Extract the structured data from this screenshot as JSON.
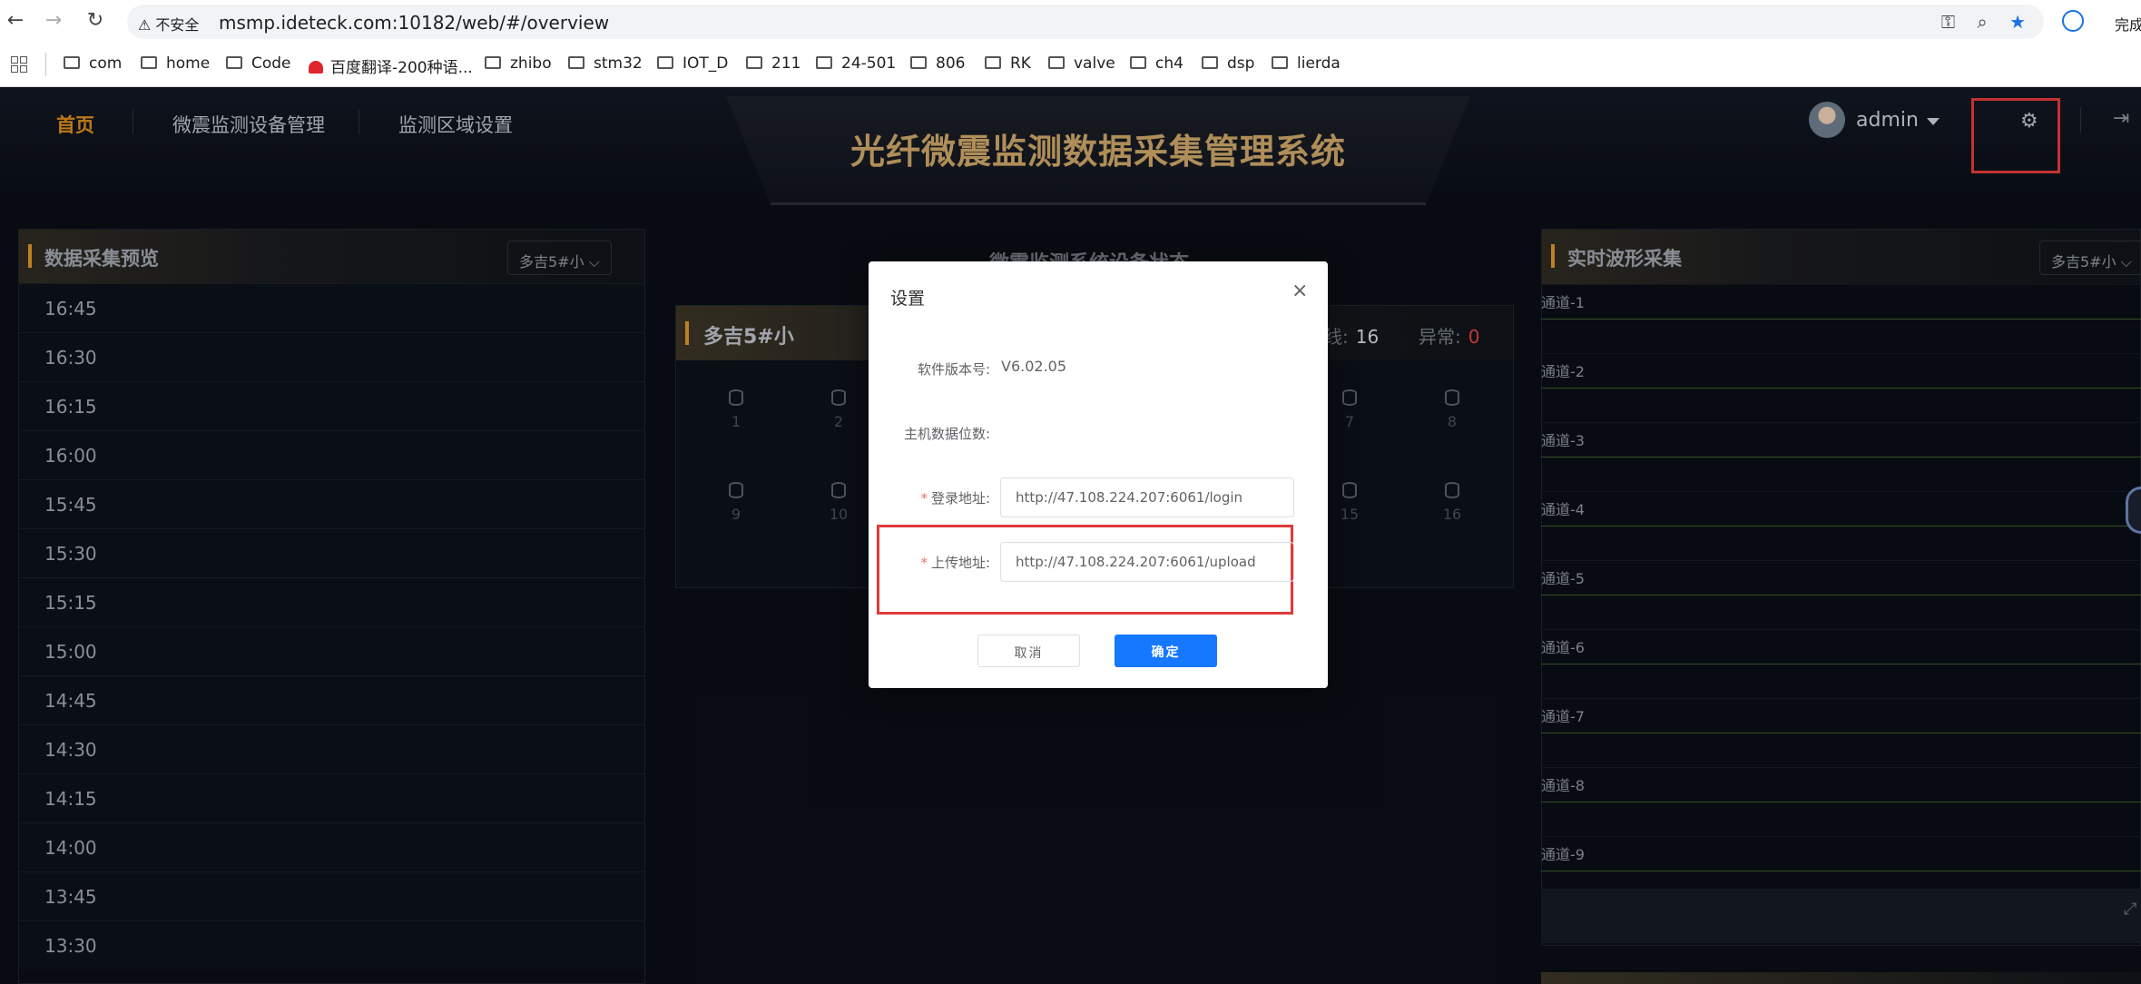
{
  "browser": {
    "back": "←",
    "forward": "→",
    "reload": "↻",
    "security_warning": "⚠ 不安全",
    "url": "msmp.ideteck.com:10182/web/#/overview",
    "finish_text": "完成",
    "bookmarks": [
      "com",
      "home",
      "Code",
      "百度翻译-200种语...",
      "zhibo",
      "stm32",
      "IOT_D",
      "211",
      "24-501",
      "806",
      "RK",
      "valve",
      "ch4",
      "dsp",
      "lierda"
    ]
  },
  "app": {
    "title": "光纤微震监测数据采集管理系统",
    "nav": [
      "首页",
      "微震监测设备管理",
      "监测区域设置"
    ],
    "user": "admin"
  },
  "left_panel": {
    "title": "数据采集预览",
    "select": "多吉5#小",
    "times": [
      "16:45",
      "16:30",
      "16:15",
      "16:00",
      "15:45",
      "15:30",
      "15:15",
      "15:00",
      "14:45",
      "14:30",
      "14:15",
      "14:00",
      "13:45",
      "13:30"
    ]
  },
  "middle": {
    "title": "微震监测系统设备状态",
    "device_name": "多吉5#小",
    "online_label": "在线:",
    "online_value": "16",
    "abnormal_label": "异常:",
    "abnormal_value": "0",
    "cells": [
      "1",
      "2",
      "7",
      "8",
      "9",
      "10",
      "15",
      "16"
    ]
  },
  "right_panel": {
    "title": "实时波形采集",
    "select": "多吉5#小",
    "channels": [
      "通道-1",
      "通道-2",
      "通道-3",
      "通道-4",
      "通道-5",
      "通道-6",
      "通道-7",
      "通道-8",
      "通道-9"
    ]
  },
  "modal": {
    "title": "设置",
    "close": "×",
    "version_label": "软件版本号:",
    "version_value": "V6.02.05",
    "bits_label": "主机数据位数:",
    "login_label": "登录地址:",
    "login_value": "http://47.108.224.207:6061/login",
    "upload_label": "上传地址:",
    "upload_value": "http://47.108.224.207:6061/upload",
    "cancel": "取消",
    "ok": "确定"
  },
  "colors": {
    "accent": "#d98b1a",
    "title_gold": "#c8a266",
    "primary_button": "#1677ff",
    "highlight_red": "#e03a3a",
    "required_star": "#f56c6c"
  },
  "icons": [
    "arrow-left-icon",
    "arrow-right-icon",
    "reload-icon",
    "warning-icon",
    "key-icon",
    "zoom-icon",
    "star-icon",
    "profile-icon",
    "apps-grid-icon",
    "folder-icon",
    "gear-icon",
    "logout-icon",
    "database-icon",
    "close-icon",
    "expand-icon"
  ]
}
